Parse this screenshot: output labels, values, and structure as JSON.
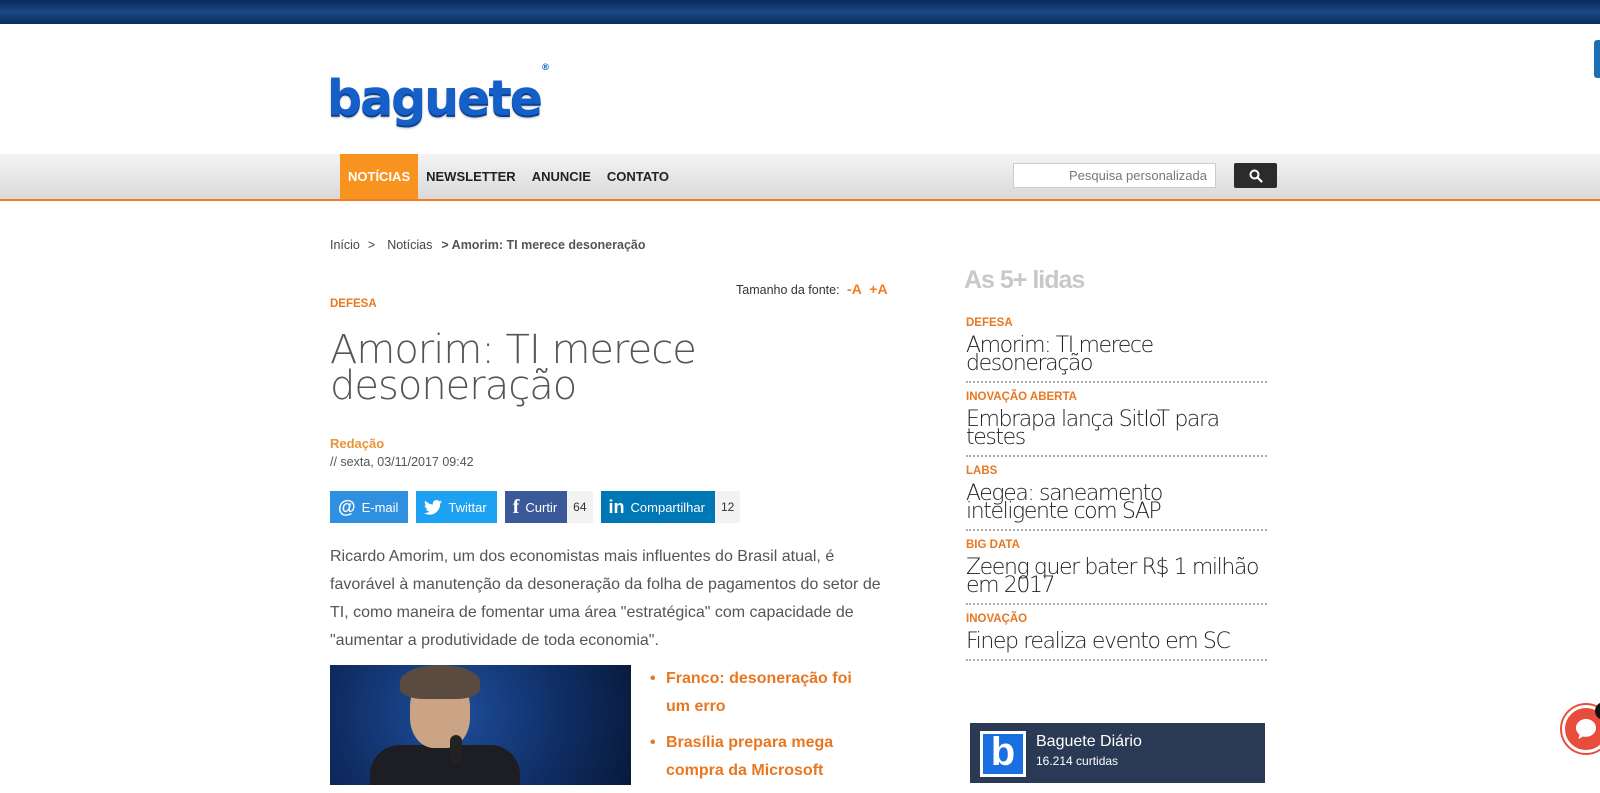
{
  "logo": {
    "text": "baguete",
    "mark": "®"
  },
  "nav": {
    "items": [
      {
        "label": "NOTÍCIAS",
        "active": true
      },
      {
        "label": "NEWSLETTER"
      },
      {
        "label": "ANUNCIE"
      },
      {
        "label": "CONTATO"
      }
    ],
    "search_placeholder": "Pesquisa personalizada",
    "search_icon": "search-icon"
  },
  "breadcrumb": {
    "home": "Início",
    "sep": ">",
    "section": "Notícias",
    "current": "> Amorim: TI merece desoneração"
  },
  "font_size": {
    "label": "Tamanho da fonte:",
    "decrease": "-A",
    "increase": "+A"
  },
  "article": {
    "category": "DEFESA",
    "title": "Amorim: TI merece desoneração",
    "author": "Redação",
    "date": "// sexta, 03/11/2017 09:42",
    "share": {
      "email": "E-mail",
      "twitter": "Twittar",
      "facebook": "Curtir",
      "facebook_count": "64",
      "linkedin": "Compartilhar",
      "linkedin_count": "12"
    },
    "body": "Ricardo Amorim, um dos economistas mais influentes do Brasil atual, é favorável à manutenção da desoneração da folha de pagamentos do setor de TI, como maneira de fomentar uma área \"estratégica\" com capacidade de \"aumentar a produtividade de toda economia\".",
    "related": [
      "Franco: desoneração foi um erro",
      "Brasília prepara mega compra da Microsoft"
    ]
  },
  "sidebar": {
    "title": "As 5+ lidas",
    "items": [
      {
        "category": "DEFESA",
        "headline": "Amorim: TI merece desoneração"
      },
      {
        "category": "INOVAÇÃO ABERTA",
        "headline": "Embrapa lança SitIoT para testes"
      },
      {
        "category": "LABS",
        "headline": "Aegea: saneamento inteligente com SAP"
      },
      {
        "category": "BIG DATA",
        "headline": "Zeeng quer bater R$ 1 milhão em 2017"
      },
      {
        "category": "INOVAÇÃO",
        "headline": "Finep realiza evento em SC"
      }
    ]
  },
  "facebook_box": {
    "name": "Baguete Diário",
    "likes": "16.214 curtidas",
    "logo_letter": "b"
  },
  "chat": {
    "badge": "1"
  },
  "colors": {
    "accent": "#f47b20",
    "nav_active": "#f7931e",
    "topbar": "#0b2a5a",
    "logo": "#1560c8"
  }
}
